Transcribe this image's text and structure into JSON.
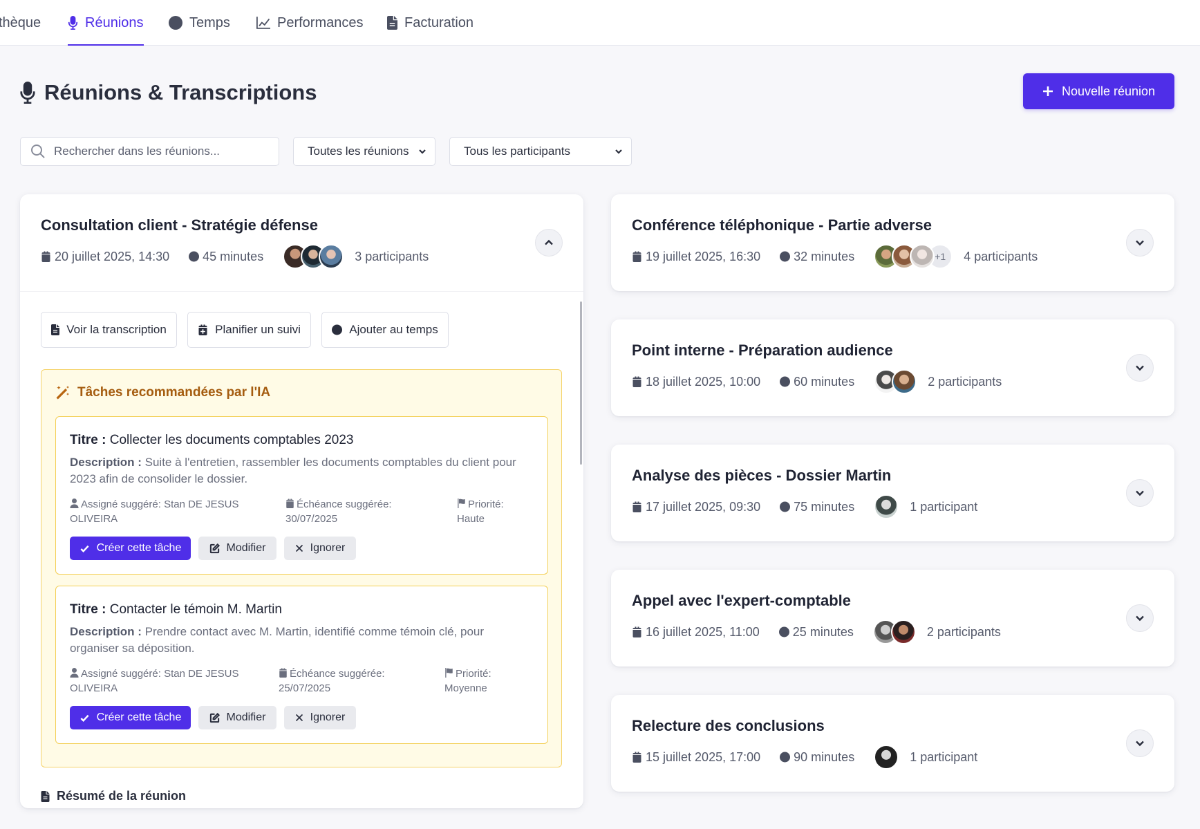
{
  "nav": {
    "tabs": [
      {
        "label": "thèque",
        "icon": "book-icon"
      },
      {
        "label": "Réunions",
        "icon": "microphone-icon",
        "active": true
      },
      {
        "label": "Temps",
        "icon": "clock-icon"
      },
      {
        "label": "Performances",
        "icon": "chart-line-icon"
      },
      {
        "label": "Facturation",
        "icon": "invoice-icon"
      }
    ]
  },
  "header": {
    "title": "Réunions & Transcriptions",
    "new_button": "Nouvelle réunion"
  },
  "filters": {
    "search_placeholder": "Rechercher dans les réunions...",
    "meetings_select": "Toutes les réunions",
    "participants_select": "Tous les participants"
  },
  "expanded_meeting": {
    "title": "Consultation client - Stratégie défense",
    "date": "20 juillet 2025, 14:30",
    "duration": "45 minutes",
    "participants": "3 participants",
    "actions": {
      "transcript": "Voir la transcription",
      "followup": "Planifier un suivi",
      "add_time": "Ajouter au temps"
    },
    "ai": {
      "title": "Tâches recommandées par l'IA",
      "tasks": [
        {
          "title_label": "Titre :",
          "title": "Collecter les documents comptables 2023",
          "desc_label": "Description :",
          "description": "Suite à l'entretien, rassembler les documents comptables du client pour 2023 afin de consolider le dossier.",
          "assignee_label": "Assigné suggéré:",
          "assignee": "Stan DE JESUS OLIVEIRA",
          "due_label": "Échéance suggérée:",
          "due": "30/07/2025",
          "priority_label": "Priorité:",
          "priority": "Haute",
          "create": "Créer cette tâche",
          "edit": "Modifier",
          "ignore": "Ignorer"
        },
        {
          "title_label": "Titre :",
          "title": "Contacter le témoin M. Martin",
          "desc_label": "Description :",
          "description": "Prendre contact avec M. Martin, identifié comme témoin clé, pour organiser sa déposition.",
          "assignee_label": "Assigné suggéré:",
          "assignee": "Stan DE JESUS OLIVEIRA",
          "due_label": "Échéance suggérée:",
          "due": "25/07/2025",
          "priority_label": "Priorité:",
          "priority": "Moyenne",
          "create": "Créer cette tâche",
          "edit": "Modifier",
          "ignore": "Ignorer"
        }
      ]
    },
    "summary_label": "Résumé de la réunion"
  },
  "meetings": [
    {
      "title": "Conférence téléphonique - Partie adverse",
      "date": "19 juillet 2025, 16:30",
      "duration": "32 minutes",
      "participants": "4 participants",
      "more": "+1"
    },
    {
      "title": "Point interne - Préparation audience",
      "date": "18 juillet 2025, 10:00",
      "duration": "60 minutes",
      "participants": "2 participants"
    },
    {
      "title": "Analyse des pièces - Dossier Martin",
      "date": "17 juillet 2025, 09:30",
      "duration": "75 minutes",
      "participants": "1 participant"
    },
    {
      "title": "Appel avec l'expert-comptable",
      "date": "16 juillet 2025, 11:00",
      "duration": "25 minutes",
      "participants": "2 participants"
    },
    {
      "title": "Relecture des conclusions",
      "date": "15 juillet 2025, 17:00",
      "duration": "90 minutes",
      "participants": "1 participant"
    }
  ],
  "colors": {
    "accent": "#4f2ee8",
    "ai_bg": "#fffbe6",
    "ai_border": "#f5d36a",
    "ai_title": "#a55c0f"
  }
}
